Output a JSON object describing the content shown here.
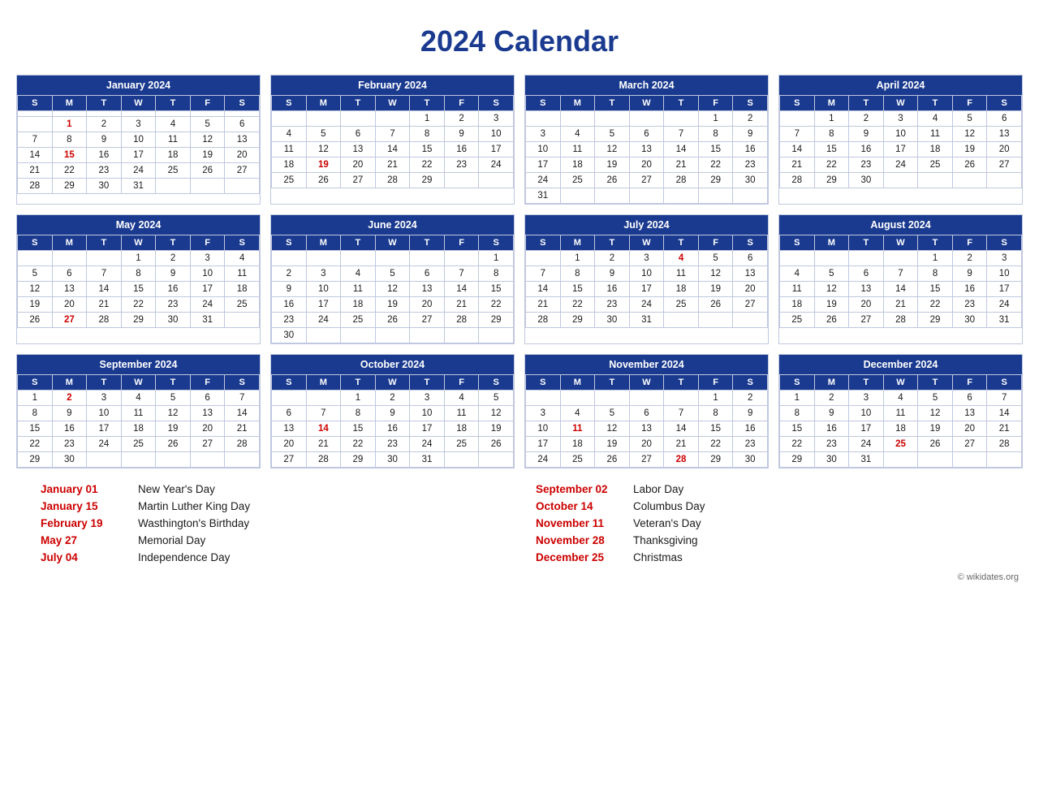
{
  "title": "2024 Calendar",
  "months": [
    {
      "name": "January 2024",
      "days": [
        [
          "",
          "",
          "",
          "",
          "",
          "",
          ""
        ],
        [
          "",
          "1",
          "2",
          "3",
          "4",
          "5",
          "6"
        ],
        [
          "7",
          "8",
          "9",
          "10",
          "11",
          "12",
          "13"
        ],
        [
          "14",
          "15",
          "16",
          "17",
          "18",
          "19",
          "20"
        ],
        [
          "21",
          "22",
          "23",
          "24",
          "25",
          "26",
          "27"
        ],
        [
          "28",
          "29",
          "30",
          "31",
          "",
          "",
          ""
        ]
      ],
      "holidays": [
        "1",
        "15"
      ]
    },
    {
      "name": "February 2024",
      "days": [
        [
          "",
          "",
          "",
          "",
          "1",
          "2",
          "3"
        ],
        [
          "4",
          "5",
          "6",
          "7",
          "8",
          "9",
          "10"
        ],
        [
          "11",
          "12",
          "13",
          "14",
          "15",
          "16",
          "17"
        ],
        [
          "18",
          "19",
          "20",
          "21",
          "22",
          "23",
          "24"
        ],
        [
          "25",
          "26",
          "27",
          "28",
          "29",
          "",
          ""
        ]
      ],
      "holidays": [
        "19"
      ]
    },
    {
      "name": "March 2024",
      "days": [
        [
          "",
          "",
          "",
          "",
          "",
          "1",
          "2"
        ],
        [
          "3",
          "4",
          "5",
          "6",
          "7",
          "8",
          "9"
        ],
        [
          "10",
          "11",
          "12",
          "13",
          "14",
          "15",
          "16"
        ],
        [
          "17",
          "18",
          "19",
          "20",
          "21",
          "22",
          "23"
        ],
        [
          "24",
          "25",
          "26",
          "27",
          "28",
          "29",
          "30"
        ],
        [
          "31",
          "",
          "",
          "",
          "",
          "",
          ""
        ]
      ],
      "holidays": []
    },
    {
      "name": "April 2024",
      "days": [
        [
          "",
          "1",
          "2",
          "3",
          "4",
          "5",
          "6"
        ],
        [
          "7",
          "8",
          "9",
          "10",
          "11",
          "12",
          "13"
        ],
        [
          "14",
          "15",
          "16",
          "17",
          "18",
          "19",
          "20"
        ],
        [
          "21",
          "22",
          "23",
          "24",
          "25",
          "26",
          "27"
        ],
        [
          "28",
          "29",
          "30",
          "",
          "",
          "",
          ""
        ]
      ],
      "holidays": []
    },
    {
      "name": "May 2024",
      "days": [
        [
          "",
          "",
          "",
          "1",
          "2",
          "3",
          "4"
        ],
        [
          "5",
          "6",
          "7",
          "8",
          "9",
          "10",
          "11"
        ],
        [
          "12",
          "13",
          "14",
          "15",
          "16",
          "17",
          "18"
        ],
        [
          "19",
          "20",
          "21",
          "22",
          "23",
          "24",
          "25"
        ],
        [
          "26",
          "27",
          "28",
          "29",
          "30",
          "31",
          ""
        ]
      ],
      "holidays": [
        "27"
      ]
    },
    {
      "name": "June 2024",
      "days": [
        [
          "",
          "",
          "",
          "",
          "",
          "",
          "1"
        ],
        [
          "2",
          "3",
          "4",
          "5",
          "6",
          "7",
          "8"
        ],
        [
          "9",
          "10",
          "11",
          "12",
          "13",
          "14",
          "15"
        ],
        [
          "16",
          "17",
          "18",
          "19",
          "20",
          "21",
          "22"
        ],
        [
          "23",
          "24",
          "25",
          "26",
          "27",
          "28",
          "29"
        ],
        [
          "30",
          "",
          "",
          "",
          "",
          "",
          ""
        ]
      ],
      "holidays": []
    },
    {
      "name": "July 2024",
      "days": [
        [
          "",
          "1",
          "2",
          "3",
          "4",
          "5",
          "6"
        ],
        [
          "7",
          "8",
          "9",
          "10",
          "11",
          "12",
          "13"
        ],
        [
          "14",
          "15",
          "16",
          "17",
          "18",
          "19",
          "20"
        ],
        [
          "21",
          "22",
          "23",
          "24",
          "25",
          "26",
          "27"
        ],
        [
          "28",
          "29",
          "30",
          "31",
          "",
          "",
          ""
        ]
      ],
      "holidays": [
        "4"
      ]
    },
    {
      "name": "August 2024",
      "days": [
        [
          "",
          "",
          "",
          "",
          "1",
          "2",
          "3"
        ],
        [
          "4",
          "5",
          "6",
          "7",
          "8",
          "9",
          "10"
        ],
        [
          "11",
          "12",
          "13",
          "14",
          "15",
          "16",
          "17"
        ],
        [
          "18",
          "19",
          "20",
          "21",
          "22",
          "23",
          "24"
        ],
        [
          "25",
          "26",
          "27",
          "28",
          "29",
          "30",
          "31"
        ]
      ],
      "holidays": []
    },
    {
      "name": "September 2024",
      "days": [
        [
          "1",
          "2",
          "3",
          "4",
          "5",
          "6",
          "7"
        ],
        [
          "8",
          "9",
          "10",
          "11",
          "12",
          "13",
          "14"
        ],
        [
          "15",
          "16",
          "17",
          "18",
          "19",
          "20",
          "21"
        ],
        [
          "22",
          "23",
          "24",
          "25",
          "26",
          "27",
          "28"
        ],
        [
          "29",
          "30",
          "",
          "",
          "",
          "",
          ""
        ]
      ],
      "holidays": [
        "2"
      ]
    },
    {
      "name": "October 2024",
      "days": [
        [
          "",
          "",
          "1",
          "2",
          "3",
          "4",
          "5"
        ],
        [
          "6",
          "7",
          "8",
          "9",
          "10",
          "11",
          "12"
        ],
        [
          "13",
          "14",
          "15",
          "16",
          "17",
          "18",
          "19"
        ],
        [
          "20",
          "21",
          "22",
          "23",
          "24",
          "25",
          "26"
        ],
        [
          "27",
          "28",
          "29",
          "30",
          "31",
          "",
          ""
        ]
      ],
      "holidays": [
        "14"
      ]
    },
    {
      "name": "November 2024",
      "days": [
        [
          "",
          "",
          "",
          "",
          "",
          "1",
          "2"
        ],
        [
          "3",
          "4",
          "5",
          "6",
          "7",
          "8",
          "9"
        ],
        [
          "10",
          "11",
          "12",
          "13",
          "14",
          "15",
          "16"
        ],
        [
          "17",
          "18",
          "19",
          "20",
          "21",
          "22",
          "23"
        ],
        [
          "24",
          "25",
          "26",
          "27",
          "28",
          "29",
          "30"
        ]
      ],
      "holidays": [
        "11",
        "28"
      ]
    },
    {
      "name": "December 2024",
      "days": [
        [
          "1",
          "2",
          "3",
          "4",
          "5",
          "6",
          "7"
        ],
        [
          "8",
          "9",
          "10",
          "11",
          "12",
          "13",
          "14"
        ],
        [
          "15",
          "16",
          "17",
          "18",
          "19",
          "20",
          "21"
        ],
        [
          "22",
          "23",
          "24",
          "25",
          "26",
          "27",
          "28"
        ],
        [
          "29",
          "30",
          "31",
          "",
          "",
          "",
          ""
        ]
      ],
      "holidays": [
        "25"
      ]
    }
  ],
  "holidays_list_left": [
    {
      "date": "January 01",
      "name": "New Year's Day"
    },
    {
      "date": "January 15",
      "name": "Martin Luther King Day"
    },
    {
      "date": "February 19",
      "name": "Wasthington's Birthday"
    },
    {
      "date": "May 27",
      "name": "Memorial Day"
    },
    {
      "date": "July 04",
      "name": "Independence Day"
    }
  ],
  "holidays_list_right": [
    {
      "date": "September 02",
      "name": "Labor Day"
    },
    {
      "date": "October 14",
      "name": "Columbus Day"
    },
    {
      "date": "November 11",
      "name": "Veteran's Day"
    },
    {
      "date": "November 28",
      "name": "Thanksgiving"
    },
    {
      "date": "December 25",
      "name": "Christmas"
    }
  ],
  "copyright": "© wikidates.org",
  "weekdays": [
    "S",
    "M",
    "T",
    "W",
    "T",
    "F",
    "S"
  ]
}
